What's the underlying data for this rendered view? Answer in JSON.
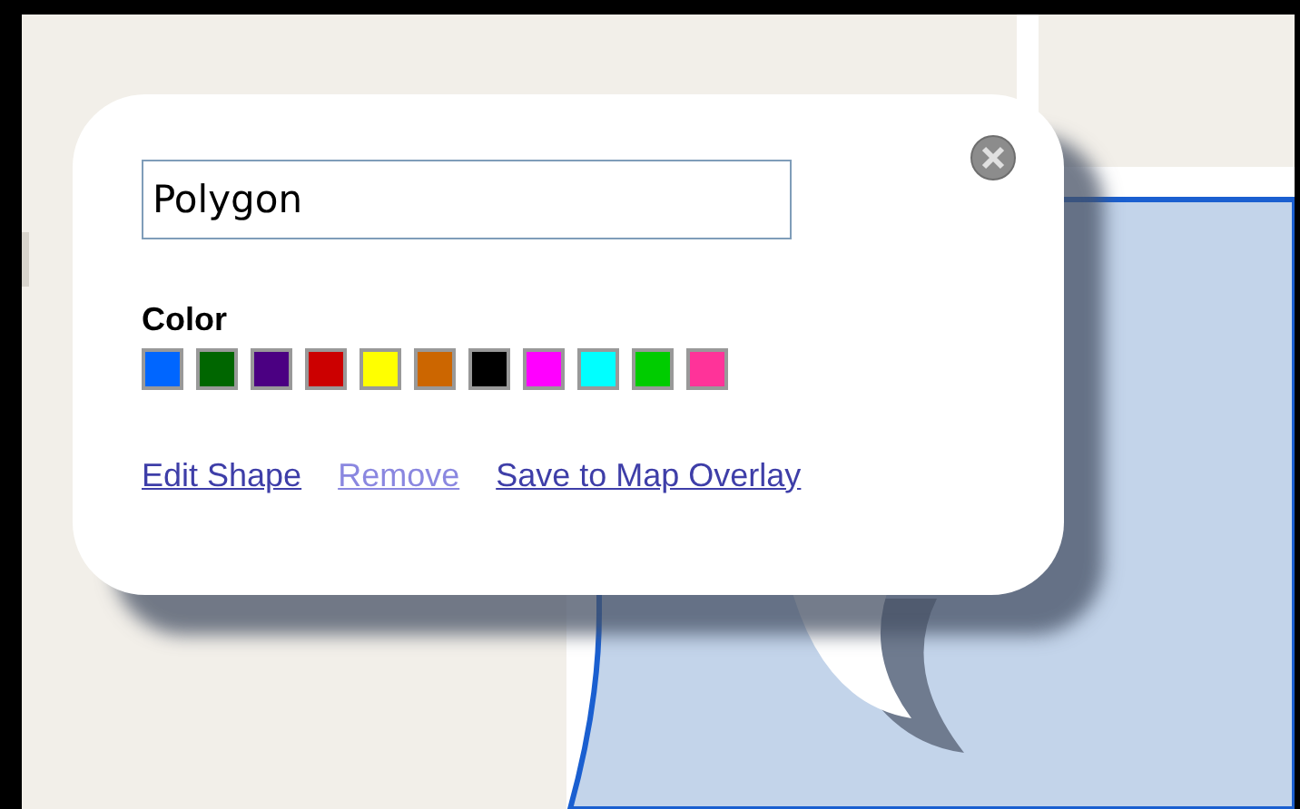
{
  "popup": {
    "name_field": {
      "value": "Polygon"
    },
    "color_label": "Color",
    "swatches": [
      {
        "color": "#0066ff"
      },
      {
        "color": "#006600"
      },
      {
        "color": "#4b0082"
      },
      {
        "color": "#cc0000"
      },
      {
        "color": "#ffff00"
      },
      {
        "color": "#cc6600"
      },
      {
        "color": "#000000"
      },
      {
        "color": "#ff00ff"
      },
      {
        "color": "#00ffff"
      },
      {
        "color": "#00cc00"
      },
      {
        "color": "#ff3399"
      }
    ],
    "links": [
      {
        "label": "Edit Shape",
        "disabled": false
      },
      {
        "label": "Remove",
        "disabled": true
      },
      {
        "label": "Save to Map Overlay",
        "disabled": false
      }
    ]
  }
}
